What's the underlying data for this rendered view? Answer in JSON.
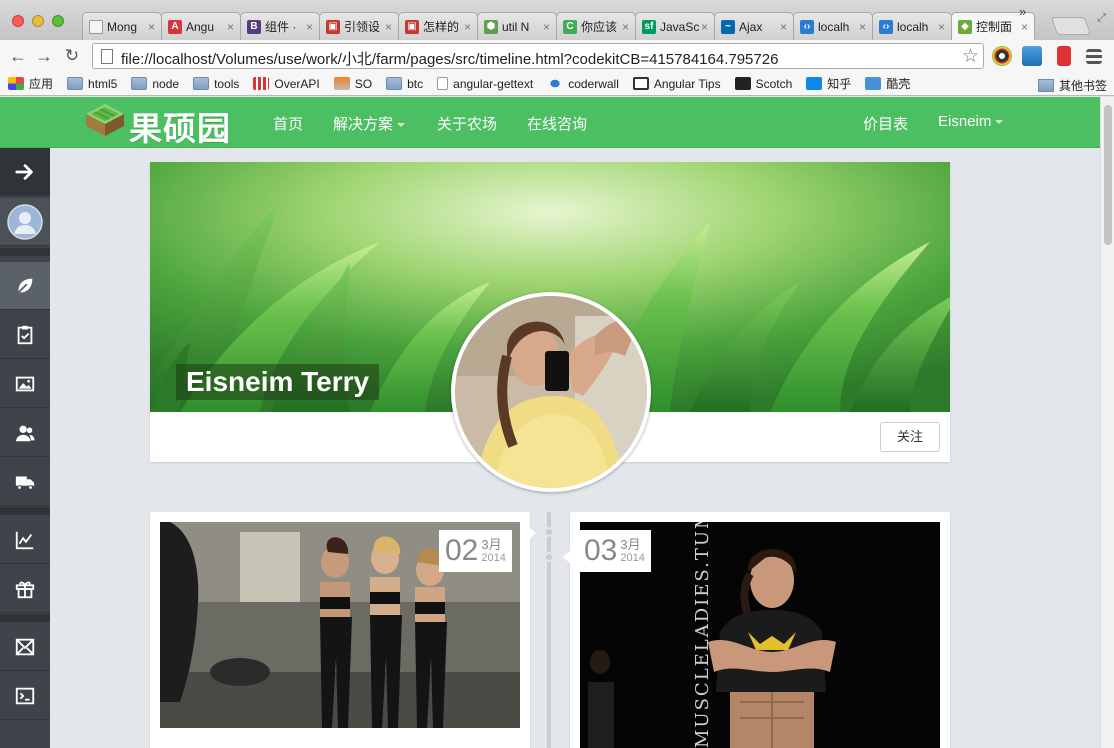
{
  "browser": {
    "tabs": [
      {
        "title": "Mong",
        "icon": "page-icon",
        "color": "#f4f4f4"
      },
      {
        "title": "Angu",
        "icon": "angular-icon",
        "color": "#d5363c"
      },
      {
        "title": "组件 ·",
        "icon": "bootstrap-icon",
        "color": "#563d7c"
      },
      {
        "title": "引领设",
        "icon": "zhihu-flag-icon",
        "color": "#c9372c"
      },
      {
        "title": "怎样的",
        "icon": "zhihu-flag-icon",
        "color": "#c9372c"
      },
      {
        "title": "util N",
        "icon": "nodejs-icon",
        "color": "#5fa04e"
      },
      {
        "title": "你应该",
        "icon": "c-icon",
        "color": "#3fae56"
      },
      {
        "title": "JavaSc",
        "icon": "sf-icon",
        "color": "#009a61"
      },
      {
        "title": "Ajax",
        "icon": "jquery-icon",
        "color": "#0868ac"
      },
      {
        "title": "localh",
        "icon": "codekit-icon",
        "color": "#2a7bd6"
      },
      {
        "title": "localh",
        "icon": "codekit-icon",
        "color": "#2a7bd6"
      },
      {
        "title": "控制面",
        "icon": "farm-icon",
        "color": "#6aaa3a"
      }
    ],
    "tab_close": "×",
    "url": "file://localhost/Volumes/use/work/小北/farm/pages/src/timeline.html?codekitCB=415784164.795726",
    "bookmarks": [
      {
        "label": "应用",
        "icon": "apps-grid-icon"
      },
      {
        "label": "html5",
        "icon": "folder-icon"
      },
      {
        "label": "node",
        "icon": "folder-icon"
      },
      {
        "label": "tools",
        "icon": "folder-icon"
      },
      {
        "label": "OverAPI",
        "icon": "overapi-icon"
      },
      {
        "label": "SO",
        "icon": "stackoverflow-icon"
      },
      {
        "label": "btc",
        "icon": "folder-icon"
      },
      {
        "label": "angular-gettext",
        "icon": "page-icon"
      },
      {
        "label": "coderwall",
        "icon": "coderwall-icon"
      },
      {
        "label": "Angular Tips",
        "icon": "angular-tips-icon"
      },
      {
        "label": "Scotch",
        "icon": "scotch-icon"
      },
      {
        "label": "知乎",
        "icon": "zhihu-icon"
      },
      {
        "label": "酷壳",
        "icon": "coolshell-icon"
      }
    ],
    "bookmarks_more": "»",
    "other_bookmarks": "其他书签"
  },
  "site": {
    "brand": "果硕园",
    "nav": {
      "home": "首页",
      "solutions": "解决方案",
      "about": "关于农场",
      "consult": "在线咨询",
      "pricing": "价目表",
      "user": "Eisneim"
    }
  },
  "sidebar": {
    "items": [
      {
        "name": "toggle",
        "icon": "arrow-right-icon"
      },
      {
        "name": "avatar",
        "icon": "user-avatar-icon"
      },
      {
        "name": "farm",
        "icon": "leaf-icon"
      },
      {
        "name": "tasks",
        "icon": "clipboard-check-icon"
      },
      {
        "name": "gallery",
        "icon": "image-icon"
      },
      {
        "name": "users",
        "icon": "users-icon"
      },
      {
        "name": "delivery",
        "icon": "truck-icon"
      },
      {
        "name": "stats",
        "icon": "line-chart-icon"
      },
      {
        "name": "gifts",
        "icon": "gift-icon"
      },
      {
        "name": "mail",
        "icon": "mail-icon"
      },
      {
        "name": "terminal",
        "icon": "terminal-icon"
      }
    ]
  },
  "profile": {
    "name": "Eisneim Terry",
    "follow_label": "关注"
  },
  "timeline": {
    "posts": [
      {
        "day": "02",
        "month": "3月",
        "year": "2014"
      },
      {
        "day": "03",
        "month": "3月",
        "year": "2014"
      }
    ]
  },
  "colors": {
    "brand_green": "#4cbf63",
    "sidebar_dark": "#3e4449",
    "page_bg": "#e3e6ea"
  }
}
